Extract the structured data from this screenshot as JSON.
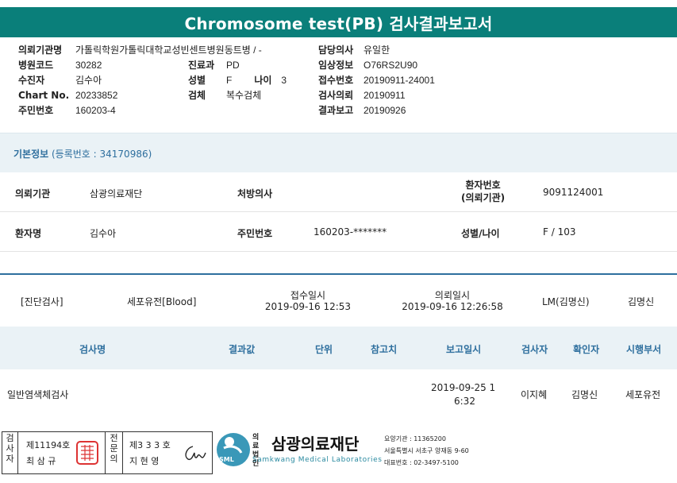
{
  "title": "Chromosome test(PB) 검사결과보고서",
  "header": {
    "left": [
      {
        "label": "의뢰기관명",
        "value": "가톨릭학원가톨릭대학교성빈센트병원"
      },
      {
        "label": "병원코드",
        "value": "30282"
      },
      {
        "label": "수진자",
        "value": "김수아"
      },
      {
        "label": "Chart No.",
        "value": "20233852"
      },
      {
        "label": "주민번호",
        "value": "160203-4"
      }
    ],
    "middle": [
      {
        "label": "진료과",
        "value": "PD"
      },
      {
        "label": "성별",
        "value": "F"
      },
      {
        "label": "검체",
        "value": "복수검체"
      }
    ],
    "dept_ward": "동트병 / -",
    "age_label": "나이",
    "age_value": "3",
    "right": [
      {
        "label": "담당의사",
        "value": "유일한"
      },
      {
        "label": "임상정보",
        "value": "O76RS2U90"
      },
      {
        "label": "접수번호",
        "value": "20190911-24001"
      },
      {
        "label": "검사의뢰",
        "value": "20190911"
      },
      {
        "label": "결과보고",
        "value": "20190926"
      }
    ]
  },
  "basic_info": {
    "title": "기본정보",
    "reg": "(등록번호 : 34170986)",
    "institution_label": "의뢰기관",
    "institution_value": "삼광의료재단",
    "doctor_label": "처방의사",
    "doctor_value": "",
    "patient_no_label_1": "환자번호",
    "patient_no_label_2": "(의뢰기관)",
    "patient_no_value": "9091124001",
    "patient_name_label": "환자명",
    "patient_name_value": "김수아",
    "rrn_label": "주민번호",
    "rrn_value": "160203-*******",
    "sex_age_label": "성별/나이",
    "sex_age_value": "F / 103"
  },
  "order": {
    "category": "[진단검사]",
    "test": "세포유전[Blood]",
    "received_label": "접수일시",
    "received_value": "2019-09-16 12:53",
    "requested_label": "의뢰일시",
    "requested_value": "2019-09-16 12:26:58",
    "lm": "LM(김명신)",
    "doctor": "김명신"
  },
  "table": {
    "headers": [
      "검사명",
      "결과값",
      "단위",
      "참고치",
      "보고일시",
      "검사자",
      "확인자",
      "시행부서"
    ],
    "row": {
      "name": "일반염색체검사",
      "report_line1": "2019-09-25 1",
      "report_line2": "6:32",
      "tester": "이지혜",
      "confirmer": "김명신",
      "dept": "세포유전"
    }
  },
  "signature": {
    "tester_label": [
      "검",
      "사",
      "자"
    ],
    "tester_no": "제11194호",
    "tester_name": "최 삼 규",
    "specialist_label": [
      "전",
      "문",
      "의"
    ],
    "specialist_no": "제3 3 3 호",
    "specialist_name": "지 현 영"
  },
  "logo": {
    "abbr": "SML",
    "type_1": "의료",
    "type_2": "법인",
    "name": "삼광의료재단",
    "eng": "Samkwang Medical Laboratories",
    "code": "요양기관 : 11365200",
    "address": "서울특별시 서초구 양재동 9-60",
    "phone": "대표번호 : 02-3497-5100"
  },
  "colors": {
    "title_bar": "#0a7f7a",
    "accent_blue": "#2e6f9e",
    "panel_bg": "#eaf2f6"
  }
}
